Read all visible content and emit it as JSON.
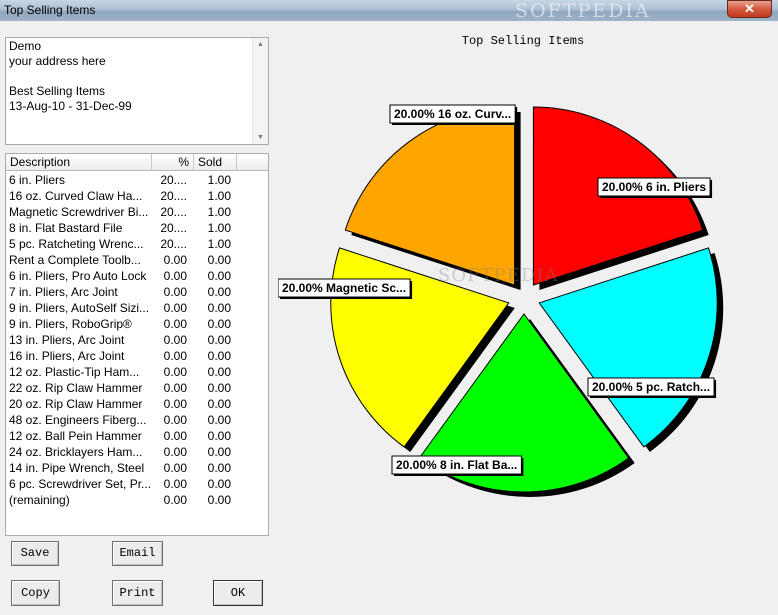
{
  "window": {
    "title": "Top Selling Items",
    "watermark": "SOFTPEDIA",
    "close_label": "✕"
  },
  "header": {
    "lines": [
      "Demo",
      "your address here",
      "",
      "Best Selling Items",
      "13-Aug-10 - 31-Dec-99"
    ]
  },
  "list": {
    "columns": [
      "Description",
      "%",
      "Sold"
    ],
    "rows": [
      {
        "desc": "6 in. Pliers",
        "pct": "20....",
        "sold": "1.00"
      },
      {
        "desc": "16 oz. Curved Claw Ha...",
        "pct": "20....",
        "sold": "1.00"
      },
      {
        "desc": "Magnetic Screwdriver Bi...",
        "pct": "20....",
        "sold": "1.00"
      },
      {
        "desc": "8 in. Flat Bastard File",
        "pct": "20....",
        "sold": "1.00"
      },
      {
        "desc": "5 pc. Ratcheting Wrenc...",
        "pct": "20....",
        "sold": "1.00"
      },
      {
        "desc": "Rent a Complete Toolb...",
        "pct": "0.00",
        "sold": "0.00"
      },
      {
        "desc": "6 in. Pliers, Pro Auto Lock",
        "pct": "0.00",
        "sold": "0.00"
      },
      {
        "desc": "7 in. Pliers, Arc Joint",
        "pct": "0.00",
        "sold": "0.00"
      },
      {
        "desc": "9 in. Pliers, AutoSelf Sizi...",
        "pct": "0.00",
        "sold": "0.00"
      },
      {
        "desc": "9 in. Pliers, RoboGrip®",
        "pct": "0.00",
        "sold": "0.00"
      },
      {
        "desc": "13 in. Pliers, Arc Joint",
        "pct": "0.00",
        "sold": "0.00"
      },
      {
        "desc": "16 in. Pliers, Arc Joint",
        "pct": "0.00",
        "sold": "0.00"
      },
      {
        "desc": "12 oz. Plastic-Tip Ham...",
        "pct": "0.00",
        "sold": "0.00"
      },
      {
        "desc": "22 oz. Rip Claw Hammer",
        "pct": "0.00",
        "sold": "0.00"
      },
      {
        "desc": "20 oz. Rip Claw Hammer",
        "pct": "0.00",
        "sold": "0.00"
      },
      {
        "desc": "48 oz. Engineers Fiberg...",
        "pct": "0.00",
        "sold": "0.00"
      },
      {
        "desc": "12 oz. Ball Pein Hammer",
        "pct": "0.00",
        "sold": "0.00"
      },
      {
        "desc": "24 oz. Bricklayers Ham...",
        "pct": "0.00",
        "sold": "0.00"
      },
      {
        "desc": "14 in. Pipe Wrench, Steel",
        "pct": "0.00",
        "sold": "0.00"
      },
      {
        "desc": "6 pc. Screwdriver Set, Pr...",
        "pct": "0.00",
        "sold": "0.00"
      },
      {
        "desc": "(remaining)",
        "pct": "0.00",
        "sold": "0.00"
      }
    ]
  },
  "buttons": {
    "save": "Save",
    "email": "Email",
    "copy": "Copy",
    "print": "Print",
    "ok": "OK"
  },
  "chart_data": {
    "type": "pie",
    "title": "Top Selling Items",
    "slices": [
      {
        "label": "20.00% 6 in. Pliers",
        "value": 20,
        "color": "#ff0000"
      },
      {
        "label": "20.00% 5 pc. Ratch...",
        "value": 20,
        "color": "#00ffff"
      },
      {
        "label": "20.00% 8 in. Flat Ba...",
        "value": 20,
        "color": "#00ff00"
      },
      {
        "label": "20.00% Magnetic Sc...",
        "value": 20,
        "color": "#ffff00"
      },
      {
        "label": "20.00% 16 oz. Curv...",
        "value": 20,
        "color": "#ffa500"
      }
    ],
    "exploded": true,
    "shadow": true,
    "watermark": "SOFTPEDIA"
  }
}
